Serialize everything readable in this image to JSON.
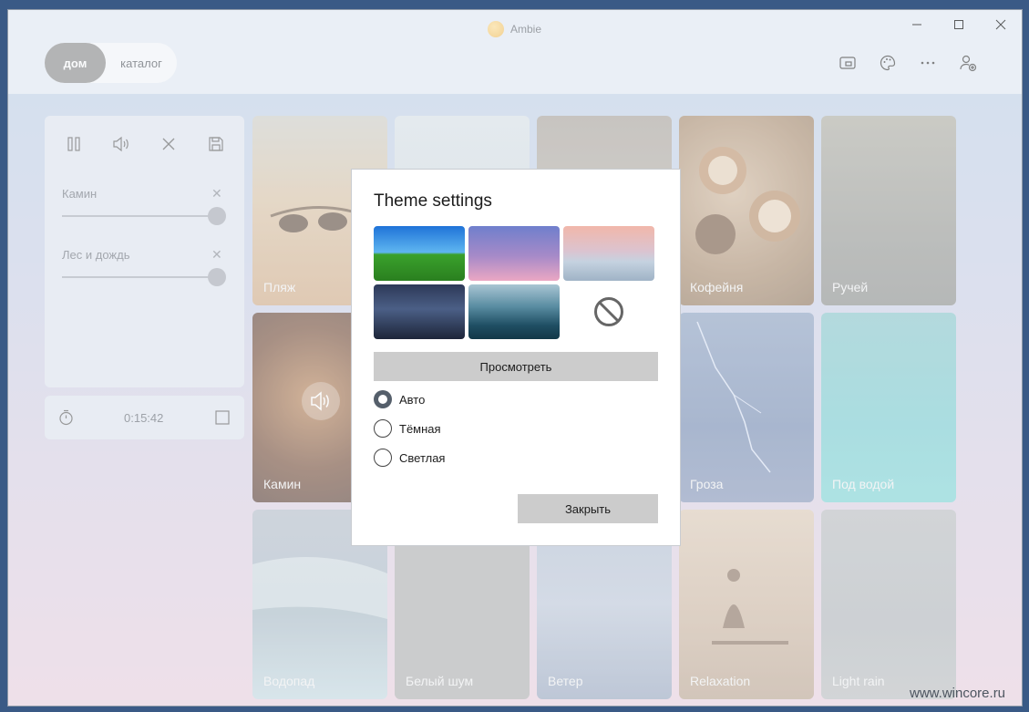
{
  "window": {
    "title": "Ambie"
  },
  "nav": {
    "home_label": "дом",
    "catalog_label": "каталог"
  },
  "player": {
    "sounds": [
      {
        "name": "Камин",
        "volume": 1.0
      },
      {
        "name": "Лес и дождь",
        "volume": 1.0
      }
    ],
    "timer": "0:15:42"
  },
  "tiles": [
    {
      "label": "Пляж"
    },
    {
      "label": ""
    },
    {
      "label": ""
    },
    {
      "label": "Кофейня"
    },
    {
      "label": "Ручей"
    },
    {
      "label": "Камин",
      "playing": true
    },
    {
      "label": ""
    },
    {
      "label": ""
    },
    {
      "label": "Гроза"
    },
    {
      "label": "Под водой"
    },
    {
      "label": "Водопад"
    },
    {
      "label": "Белый шум"
    },
    {
      "label": "Ветер"
    },
    {
      "label": "Relaxation"
    },
    {
      "label": "Light rain"
    }
  ],
  "dialog": {
    "title": "Theme settings",
    "preview_label": "Просмотреть",
    "options": [
      {
        "label": "Авто",
        "checked": true
      },
      {
        "label": "Тёмная",
        "checked": false
      },
      {
        "label": "Светлая",
        "checked": false
      }
    ],
    "close_label": "Закрыть"
  },
  "watermark": "www.wincore.ru",
  "colors": {
    "titlebar": "#e8eef5",
    "panel": "#e5e9f1",
    "dialog_button": "#cccccc"
  }
}
